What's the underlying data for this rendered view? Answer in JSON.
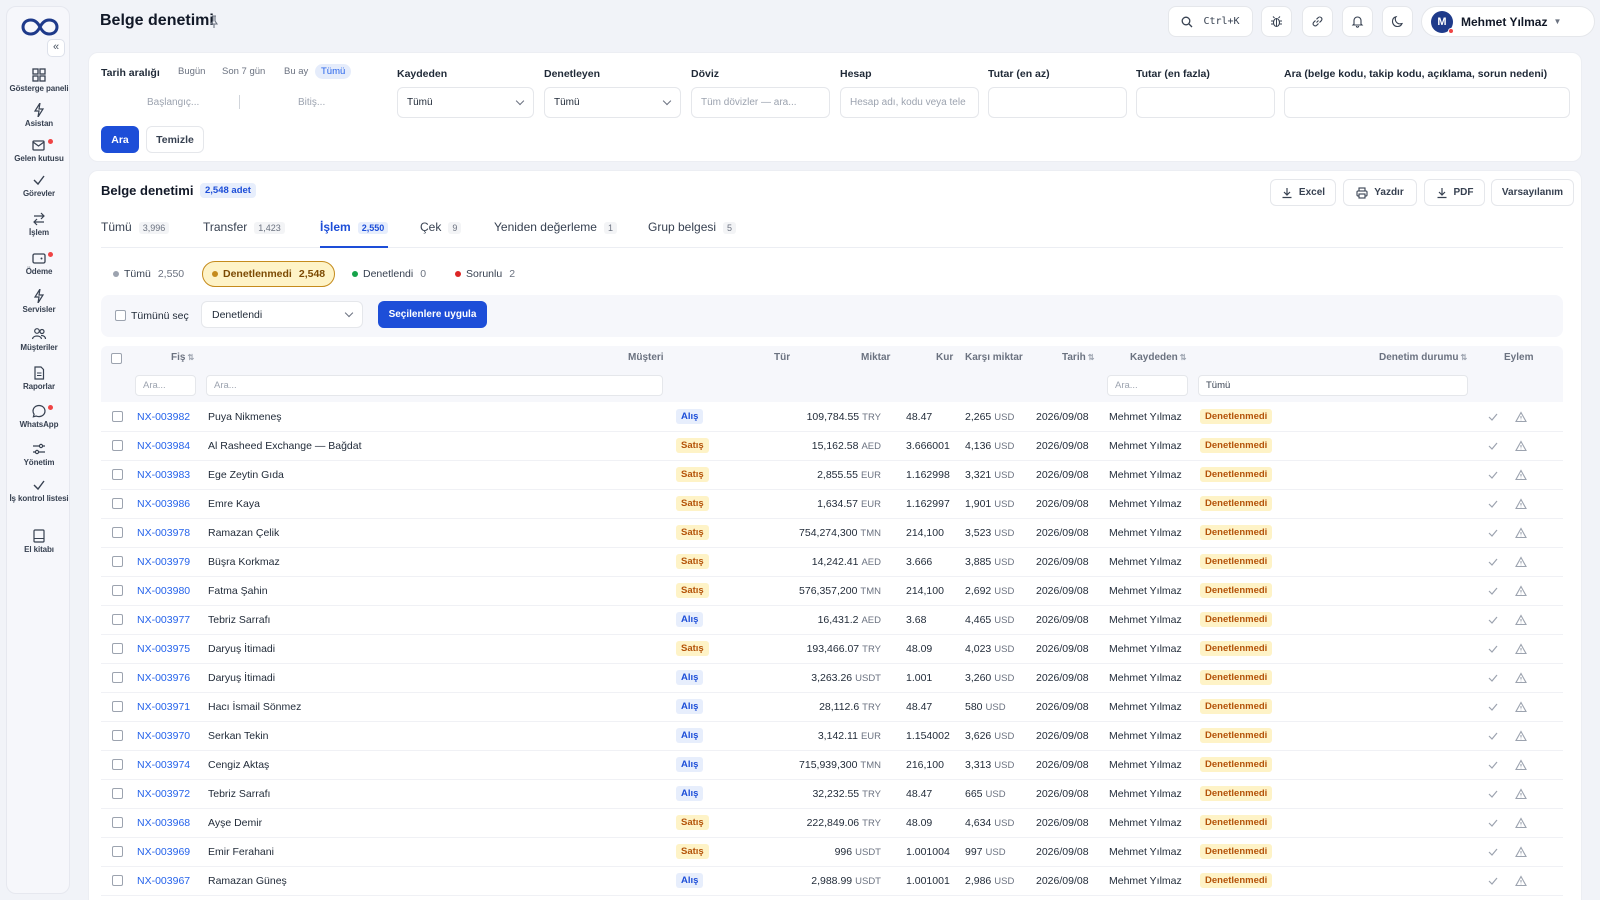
{
  "header": {
    "title": "Belge denetimi",
    "search_shortcut": "Ctrl+K",
    "user_name": "Mehmet Yılmaz",
    "user_initial": "M"
  },
  "sidebar": {
    "items": [
      {
        "label": "Gösterge paneli",
        "icon": "dashboard-icon"
      },
      {
        "label": "Asistan",
        "icon": "bolt-icon"
      },
      {
        "label": "Gelen kutusu",
        "icon": "inbox-icon"
      },
      {
        "label": "Görevler",
        "icon": "check-icon"
      },
      {
        "label": "İşlem",
        "icon": "swap-icon"
      },
      {
        "label": "Ödeme",
        "icon": "wallet-icon"
      },
      {
        "label": "Servisler",
        "icon": "bolt-icon"
      },
      {
        "label": "Müşteriler",
        "icon": "users-icon"
      },
      {
        "label": "Raporlar",
        "icon": "report-icon"
      },
      {
        "label": "WhatsApp",
        "icon": "chat-icon"
      },
      {
        "label": "Yönetim",
        "icon": "sliders-icon"
      },
      {
        "label": "İş kontrol listesi",
        "icon": "check-icon"
      },
      {
        "label": "El kitabı",
        "icon": "book-icon"
      }
    ]
  },
  "filters": {
    "date_label": "Tarih aralığı",
    "date_chips": [
      "Bugün",
      "Son 7 gün",
      "Bu ay",
      "Tümü"
    ],
    "date_start_placeholder": "Başlangıç...",
    "date_end_placeholder": "Bitiş...",
    "recorder_label": "Kaydeden",
    "recorder_value": "Tümü",
    "auditor_label": "Denetleyen",
    "auditor_value": "Tümü",
    "currency_label": "Döviz",
    "currency_placeholder": "Tüm dövizler — ara...",
    "account_label": "Hesap",
    "account_placeholder": "Hesap adı, kodu veya tele",
    "min_label": "Tutar (en az)",
    "max_label": "Tutar (en fazla)",
    "search_label": "Ara (belge kodu, takip kodu, açıklama, sorun nedeni)",
    "search_button": "Ara",
    "clear_button": "Temizle"
  },
  "main": {
    "title": "Belge denetimi",
    "count": "2,548 adet",
    "actions": {
      "excel": "Excel",
      "print": "Yazdır",
      "pdf": "PDF",
      "default": "Varsayılanım"
    },
    "tabs": [
      {
        "label": "Tümü",
        "count": "3,996"
      },
      {
        "label": "Transfer",
        "count": "1,423"
      },
      {
        "label": "İşlem",
        "count": "2,550"
      },
      {
        "label": "Çek",
        "count": "9"
      },
      {
        "label": "Yeniden değerleme",
        "count": "1"
      },
      {
        "label": "Grup belgesi",
        "count": "5"
      }
    ],
    "statuses": [
      {
        "label": "Tümü",
        "count": "2,550"
      },
      {
        "label": "Denetlenmedi",
        "count": "2,548"
      },
      {
        "label": "Denetlendi",
        "count": "0"
      },
      {
        "label": "Sorunlu",
        "count": "2"
      }
    ],
    "bulk": {
      "select_all": "Tümünü seç",
      "status_value": "Denetlendi",
      "apply": "Seçilenlere uygula"
    },
    "columns": {
      "fis": "Fiş",
      "musteri": "Müşteri",
      "tur": "Tür",
      "miktar": "Miktar",
      "kur": "Kur",
      "karsi": "Karşı miktar",
      "tarih": "Tarih",
      "kaydeden": "Kaydeden",
      "durum": "Denetim durumu",
      "eylem": "Eylem"
    },
    "column_filters": {
      "search_placeholder": "Ara...",
      "durum_value": "Tümü"
    },
    "rows": [
      {
        "fis": "NX-003982",
        "musteri": "Puya Nikmeneş",
        "tur": "Alış",
        "miktar": "109,784.55",
        "miktar_cur": "TRY",
        "kur": "48.47",
        "karsi": "2,265",
        "karsi_cur": "USD",
        "tarih": "2026/09/08",
        "kaydeden": "Mehmet Yılmaz",
        "durum": "Denetlenmedi"
      },
      {
        "fis": "NX-003984",
        "musteri": "Al Rasheed Exchange — Bağdat",
        "tur": "Satış",
        "miktar": "15,162.58",
        "miktar_cur": "AED",
        "kur": "3.666001",
        "karsi": "4,136",
        "karsi_cur": "USD",
        "tarih": "2026/09/08",
        "kaydeden": "Mehmet Yılmaz",
        "durum": "Denetlenmedi"
      },
      {
        "fis": "NX-003983",
        "musteri": "Ege Zeytin Gıda",
        "tur": "Satış",
        "miktar": "2,855.55",
        "miktar_cur": "EUR",
        "kur": "1.162998",
        "karsi": "3,321",
        "karsi_cur": "USD",
        "tarih": "2026/09/08",
        "kaydeden": "Mehmet Yılmaz",
        "durum": "Denetlenmedi"
      },
      {
        "fis": "NX-003986",
        "musteri": "Emre Kaya",
        "tur": "Satış",
        "miktar": "1,634.57",
        "miktar_cur": "EUR",
        "kur": "1.162997",
        "karsi": "1,901",
        "karsi_cur": "USD",
        "tarih": "2026/09/08",
        "kaydeden": "Mehmet Yılmaz",
        "durum": "Denetlenmedi"
      },
      {
        "fis": "NX-003978",
        "musteri": "Ramazan Çelik",
        "tur": "Satış",
        "miktar": "754,274,300",
        "miktar_cur": "TMN",
        "kur": "214,100",
        "karsi": "3,523",
        "karsi_cur": "USD",
        "tarih": "2026/09/08",
        "kaydeden": "Mehmet Yılmaz",
        "durum": "Denetlenmedi"
      },
      {
        "fis": "NX-003979",
        "musteri": "Büşra Korkmaz",
        "tur": "Satış",
        "miktar": "14,242.41",
        "miktar_cur": "AED",
        "kur": "3.666",
        "karsi": "3,885",
        "karsi_cur": "USD",
        "tarih": "2026/09/08",
        "kaydeden": "Mehmet Yılmaz",
        "durum": "Denetlenmedi"
      },
      {
        "fis": "NX-003980",
        "musteri": "Fatma Şahin",
        "tur": "Satış",
        "miktar": "576,357,200",
        "miktar_cur": "TMN",
        "kur": "214,100",
        "karsi": "2,692",
        "karsi_cur": "USD",
        "tarih": "2026/09/08",
        "kaydeden": "Mehmet Yılmaz",
        "durum": "Denetlenmedi"
      },
      {
        "fis": "NX-003977",
        "musteri": "Tebriz Sarrafı",
        "tur": "Alış",
        "miktar": "16,431.2",
        "miktar_cur": "AED",
        "kur": "3.68",
        "karsi": "4,465",
        "karsi_cur": "USD",
        "tarih": "2026/09/08",
        "kaydeden": "Mehmet Yılmaz",
        "durum": "Denetlenmedi"
      },
      {
        "fis": "NX-003975",
        "musteri": "Daryuş İtimadi",
        "tur": "Satış",
        "miktar": "193,466.07",
        "miktar_cur": "TRY",
        "kur": "48.09",
        "karsi": "4,023",
        "karsi_cur": "USD",
        "tarih": "2026/09/08",
        "kaydeden": "Mehmet Yılmaz",
        "durum": "Denetlenmedi"
      },
      {
        "fis": "NX-003976",
        "musteri": "Daryuş İtimadi",
        "tur": "Alış",
        "miktar": "3,263.26",
        "miktar_cur": "USDT",
        "kur": "1.001",
        "karsi": "3,260",
        "karsi_cur": "USD",
        "tarih": "2026/09/08",
        "kaydeden": "Mehmet Yılmaz",
        "durum": "Denetlenmedi"
      },
      {
        "fis": "NX-003971",
        "musteri": "Hacı İsmail Sönmez",
        "tur": "Alış",
        "miktar": "28,112.6",
        "miktar_cur": "TRY",
        "kur": "48.47",
        "karsi": "580",
        "karsi_cur": "USD",
        "tarih": "2026/09/08",
        "kaydeden": "Mehmet Yılmaz",
        "durum": "Denetlenmedi"
      },
      {
        "fis": "NX-003970",
        "musteri": "Serkan Tekin",
        "tur": "Alış",
        "miktar": "3,142.11",
        "miktar_cur": "EUR",
        "kur": "1.154002",
        "karsi": "3,626",
        "karsi_cur": "USD",
        "tarih": "2026/09/08",
        "kaydeden": "Mehmet Yılmaz",
        "durum": "Denetlenmedi"
      },
      {
        "fis": "NX-003974",
        "musteri": "Cengiz Aktaş",
        "tur": "Alış",
        "miktar": "715,939,300",
        "miktar_cur": "TMN",
        "kur": "216,100",
        "karsi": "3,313",
        "karsi_cur": "USD",
        "tarih": "2026/09/08",
        "kaydeden": "Mehmet Yılmaz",
        "durum": "Denetlenmedi"
      },
      {
        "fis": "NX-003972",
        "musteri": "Tebriz Sarrafı",
        "tur": "Alış",
        "miktar": "32,232.55",
        "miktar_cur": "TRY",
        "kur": "48.47",
        "karsi": "665",
        "karsi_cur": "USD",
        "tarih": "2026/09/08",
        "kaydeden": "Mehmet Yılmaz",
        "durum": "Denetlenmedi"
      },
      {
        "fis": "NX-003968",
        "musteri": "Ayşe Demir",
        "tur": "Satış",
        "miktar": "222,849.06",
        "miktar_cur": "TRY",
        "kur": "48.09",
        "karsi": "4,634",
        "karsi_cur": "USD",
        "tarih": "2026/09/08",
        "kaydeden": "Mehmet Yılmaz",
        "durum": "Denetlenmedi"
      },
      {
        "fis": "NX-003969",
        "musteri": "Emir Ferahani",
        "tur": "Satış",
        "miktar": "996",
        "miktar_cur": "USDT",
        "kur": "1.001004",
        "karsi": "997",
        "karsi_cur": "USD",
        "tarih": "2026/09/08",
        "kaydeden": "Mehmet Yılmaz",
        "durum": "Denetlenmedi"
      },
      {
        "fis": "NX-003967",
        "musteri": "Ramazan Güneş",
        "tur": "Alış",
        "miktar": "2,988.99",
        "miktar_cur": "USDT",
        "kur": "1.001001",
        "karsi": "2,986",
        "karsi_cur": "USD",
        "tarih": "2026/09/08",
        "kaydeden": "Mehmet Yılmaz",
        "durum": "Denetlenmedi"
      }
    ]
  },
  "colors": {
    "accent": "#1d4ed8",
    "warning_bg": "#fef3c7",
    "warning_text": "#b45309",
    "status_all": "#9ca3af",
    "status_pending": "#c58b1c",
    "status_done": "#16a34a",
    "status_issue": "#dc2626"
  }
}
